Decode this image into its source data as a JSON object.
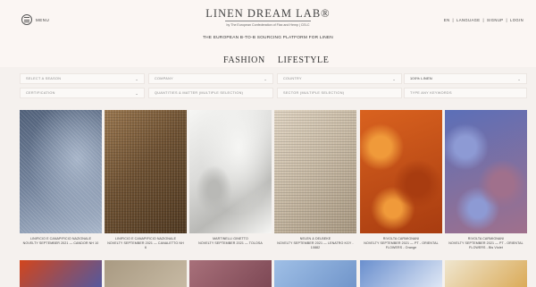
{
  "header": {
    "menu_label": "MENU",
    "logo": "LINEN DREAM LAB®",
    "logo_sub": "by The European Confederation of Flax and Hemp | CELC",
    "tagline": "THE EUROPEAN B-TO-B SOURCING PLATFORM FOR LINEN",
    "lang": "EN",
    "sep": "|",
    "language": "LANGUAGE",
    "signup": "SIGNUP",
    "login": "LOGIN"
  },
  "tabs": [
    {
      "label": "FASHION"
    },
    {
      "label": "LIFESTYLE"
    }
  ],
  "filters": {
    "season": "SELECT A SEASON",
    "company": "COMPANY",
    "country": "COUNTRY",
    "linen": "100% LINEN",
    "certification": "CERTIFICATION",
    "quantities": "QUANTITIES & MATTER (MULTIPLE SELECTION)",
    "sector": "SECTOR (MULTIPLE SELECTION)",
    "keywords_placeholder": "TYPE ANY KEYWORDS"
  },
  "products": [
    {
      "caption": "LINIFICIO E CANAPIFICIO NAZIONALE\nNOVELTY SEPTEMBER 2021 — CANDOR NH 10",
      "colors": [
        "#6f7f98",
        "#a6b4c8",
        "#4f5f78"
      ],
      "texture": "twill"
    },
    {
      "caption": "LINIFICIO E CANAPIFICIO NAZIONALE\nNOVELTY SEPTEMBER 2021 — CANALETTO NH\n6",
      "colors": [
        "#6e5132",
        "#9a774f",
        "#4f3820"
      ],
      "texture": "weave"
    },
    {
      "caption": "MARTINELLI GINETTO\nNOVELTY SEPTEMBER 2021 — TOLOSA",
      "colors": [
        "#dcdcda",
        "#f6f6f4",
        "#b9b9b6"
      ],
      "texture": "drape"
    },
    {
      "caption": "NELEN & DELBEKE\nNOVELTY SEPTEMBER 2021 — LENATRO KGY -\n10882",
      "colors": [
        "#c9bba6",
        "#e0d4c2",
        "#a89881"
      ],
      "texture": "weave"
    },
    {
      "caption": "RIVOLTA CARMIGNANI\nNOVELTY SEPTEMBER 2021 — PT - ORIENTAL\nFLOWERS - Orange",
      "colors": [
        "#d9621f",
        "#f09a3a",
        "#a83c10"
      ],
      "texture": "print"
    },
    {
      "caption": "RIVOLTA CARMIGNANI\nNOVELTY SEPTEMBER 2021 — PT - ORIENTAL\nFLOWERS - Bis Violet",
      "colors": [
        "#5b6fb8",
        "#8d9ad4",
        "#a0708c"
      ],
      "texture": "print"
    }
  ],
  "products_row2": [
    {
      "colors": [
        "#d2451c",
        "#4a5aa8"
      ]
    },
    {
      "colors": [
        "#a99a82",
        "#c9bca6"
      ]
    },
    {
      "colors": [
        "#a8707a",
        "#7a4552"
      ]
    },
    {
      "colors": [
        "#9fbfe6",
        "#6d92c8"
      ]
    },
    {
      "colors": [
        "#6a8fce",
        "#e8eef8"
      ]
    },
    {
      "colors": [
        "#efe6cf",
        "#d9a64f"
      ]
    }
  ]
}
